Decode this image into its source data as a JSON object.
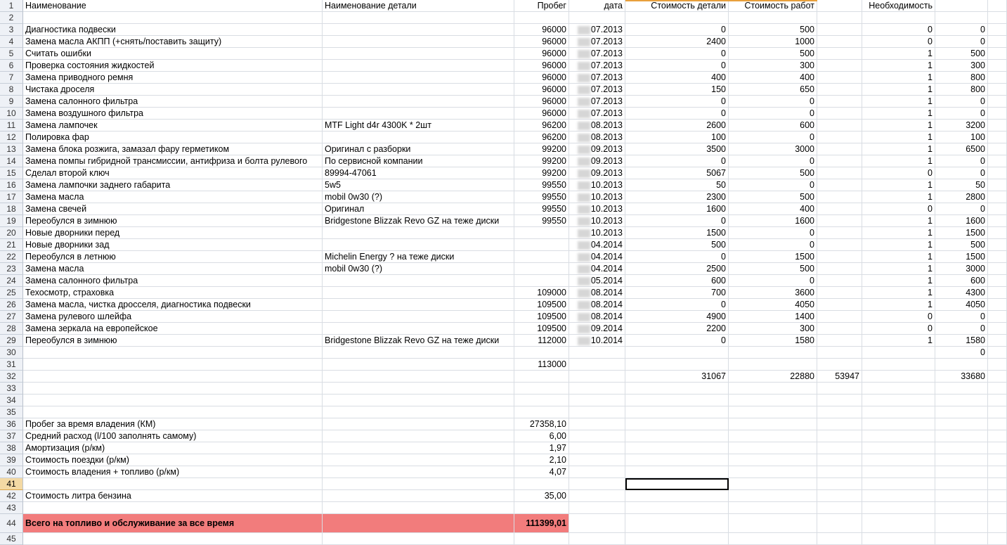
{
  "headers": [
    "Наименование",
    "Наименование детали",
    "Пробег",
    "дата",
    "Стоимость детали",
    "Стоимость работ",
    "",
    "Необходимость",
    ""
  ],
  "active_row": 41,
  "selected_cell": {
    "row": 41,
    "col": 4
  },
  "highlight_row": 44,
  "rows": [
    {
      "n": "2",
      "c": [
        "",
        "",
        "",
        "",
        "",
        "",
        "",
        "",
        ""
      ]
    },
    {
      "n": "3",
      "c": [
        "Диагностика подвески",
        "",
        "96000",
        "07.2013",
        "0",
        "500",
        "",
        "0",
        "0"
      ]
    },
    {
      "n": "4",
      "c": [
        "Замена масла АКПП (+снять/поставить защиту)",
        "",
        "96000",
        "07.2013",
        "2400",
        "1000",
        "",
        "0",
        "0"
      ]
    },
    {
      "n": "5",
      "c": [
        "Считать ошибки",
        "",
        "96000",
        "07.2013",
        "0",
        "500",
        "",
        "1",
        "500"
      ]
    },
    {
      "n": "6",
      "c": [
        "Проверка состояния жидкостей",
        "",
        "96000",
        "07.2013",
        "0",
        "300",
        "",
        "1",
        "300"
      ]
    },
    {
      "n": "7",
      "c": [
        "Замена приводного ремня",
        "",
        "96000",
        "07.2013",
        "400",
        "400",
        "",
        "1",
        "800"
      ]
    },
    {
      "n": "8",
      "c": [
        "Чистака дроселя",
        "",
        "96000",
        "07.2013",
        "150",
        "650",
        "",
        "1",
        "800"
      ]
    },
    {
      "n": "9",
      "c": [
        "Замена салонного фильтра",
        "",
        "96000",
        "07.2013",
        "0",
        "0",
        "",
        "1",
        "0"
      ]
    },
    {
      "n": "10",
      "c": [
        "Замена воздушного фильтра",
        "",
        "96000",
        "07.2013",
        "0",
        "0",
        "",
        "1",
        "0"
      ]
    },
    {
      "n": "11",
      "c": [
        "Замена лампочек",
        "MTF Light d4r 4300K * 2шт",
        "96200",
        "08.2013",
        "2600",
        "600",
        "",
        "1",
        "3200"
      ]
    },
    {
      "n": "12",
      "c": [
        "Полировка фар",
        "",
        "96200",
        "08.2013",
        "100",
        "0",
        "",
        "1",
        "100"
      ]
    },
    {
      "n": "13",
      "c": [
        "Замена блока розжига, замазал фару герметиком",
        "Оригинал с разборки",
        "99200",
        "09.2013",
        "3500",
        "3000",
        "",
        "1",
        "6500"
      ]
    },
    {
      "n": "14",
      "c": [
        "Замена помпы гибридной трансмиссии, антифриза и болта рулевого",
        "По сервисной компании",
        "99200",
        "09.2013",
        "0",
        "0",
        "",
        "1",
        "0"
      ]
    },
    {
      "n": "15",
      "c": [
        "Сделал второй ключ",
        "89994-47061",
        "99200",
        "09.2013",
        "5067",
        "500",
        "",
        "0",
        "0"
      ]
    },
    {
      "n": "16",
      "c": [
        "Замена лампочки заднего габарита",
        "5w5",
        "99550",
        "10.2013",
        "50",
        "0",
        "",
        "1",
        "50"
      ]
    },
    {
      "n": "17",
      "c": [
        "Замена масла",
        "mobil 0w30 (?)",
        "99550",
        "10.2013",
        "2300",
        "500",
        "",
        "1",
        "2800"
      ]
    },
    {
      "n": "18",
      "c": [
        "Замена свечей",
        "Оригинал",
        "99550",
        "10.2013",
        "1600",
        "400",
        "",
        "0",
        "0"
      ]
    },
    {
      "n": "19",
      "c": [
        "Переобулся в зимнюю",
        "Bridgestone Blizzak Revo GZ на теже диски",
        "99550",
        "10.2013",
        "0",
        "1600",
        "",
        "1",
        "1600"
      ]
    },
    {
      "n": "20",
      "c": [
        "Новые дворники перед",
        "",
        "",
        "10.2013",
        "1500",
        "0",
        "",
        "1",
        "1500"
      ]
    },
    {
      "n": "21",
      "c": [
        "Новые дворники зад",
        "",
        "",
        "04.2014",
        "500",
        "0",
        "",
        "1",
        "500"
      ]
    },
    {
      "n": "22",
      "c": [
        "Переобулся в летнюю",
        "Michelin Energy ? на теже диски",
        "",
        "04.2014",
        "0",
        "1500",
        "",
        "1",
        "1500"
      ]
    },
    {
      "n": "23",
      "c": [
        "Замена масла",
        "mobil 0w30 (?)",
        "",
        "04.2014",
        "2500",
        "500",
        "",
        "1",
        "3000"
      ]
    },
    {
      "n": "24",
      "c": [
        "Замена салонного фильтра",
        "",
        "",
        "05.2014",
        "600",
        "0",
        "",
        "1",
        "600"
      ]
    },
    {
      "n": "25",
      "c": [
        "Техосмотр, страховка",
        "",
        "109000",
        "08.2014",
        "700",
        "3600",
        "",
        "1",
        "4300"
      ]
    },
    {
      "n": "26",
      "c": [
        "Замена масла, чистка дросселя, диагностика подвески",
        "",
        "109500",
        "08.2014",
        "0",
        "4050",
        "",
        "1",
        "4050"
      ]
    },
    {
      "n": "27",
      "c": [
        "Замена рулевого шлейфа",
        "",
        "109500",
        "08.2014",
        "4900",
        "1400",
        "",
        "0",
        "0"
      ]
    },
    {
      "n": "28",
      "c": [
        "Замена зеркала на европейское",
        "",
        "109500",
        "09.2014",
        "2200",
        "300",
        "",
        "0",
        "0"
      ]
    },
    {
      "n": "29",
      "c": [
        "Переобулся в зимнюю",
        "Bridgestone Blizzak Revo GZ на теже диски",
        "112000",
        "10.2014",
        "0",
        "1580",
        "",
        "1",
        "1580"
      ]
    },
    {
      "n": "30",
      "c": [
        "",
        "",
        "",
        "",
        "",
        "",
        "",
        "",
        "0"
      ]
    },
    {
      "n": "31",
      "c": [
        "",
        "",
        "113000",
        "",
        "",
        "",
        "",
        "",
        ""
      ]
    },
    {
      "n": "32",
      "c": [
        "",
        "",
        "",
        "",
        "31067",
        "22880",
        "53947",
        "",
        "33680"
      ]
    },
    {
      "n": "33",
      "c": [
        "",
        "",
        "",
        "",
        "",
        "",
        "",
        "",
        ""
      ]
    },
    {
      "n": "34",
      "c": [
        "",
        "",
        "",
        "",
        "",
        "",
        "",
        "",
        ""
      ]
    },
    {
      "n": "35",
      "c": [
        "",
        "",
        "",
        "",
        "",
        "",
        "",
        "",
        ""
      ]
    },
    {
      "n": "36",
      "c": [
        "Пробег за время владения (КМ)",
        "",
        "27358,10",
        "",
        "",
        "",
        "",
        "",
        ""
      ]
    },
    {
      "n": "37",
      "c": [
        "Средний расход (l/100 заполнять самому)",
        "",
        "6,00",
        "",
        "",
        "",
        "",
        "",
        ""
      ]
    },
    {
      "n": "38",
      "c": [
        "Амортизация (р/км)",
        "",
        "1,97",
        "",
        "",
        "",
        "",
        "",
        ""
      ]
    },
    {
      "n": "39",
      "c": [
        "Стоимость поездки (р/км)",
        "",
        "2,10",
        "",
        "",
        "",
        "",
        "",
        ""
      ]
    },
    {
      "n": "40",
      "c": [
        "Стоимость владения + топливо (р/км)",
        "",
        "4,07",
        "",
        "",
        "",
        "",
        "",
        ""
      ]
    },
    {
      "n": "41",
      "c": [
        "",
        "",
        "",
        "",
        "",
        "",
        "",
        "",
        ""
      ]
    },
    {
      "n": "42",
      "c": [
        "Стоимость литра бензина",
        "",
        "35,00",
        "",
        "",
        "",
        "",
        "",
        ""
      ]
    },
    {
      "n": "43",
      "c": [
        "",
        "",
        "",
        "",
        "",
        "",
        "",
        "",
        ""
      ]
    },
    {
      "n": "44",
      "c": [
        "Всего на топливо и обслуживание за все время",
        "",
        "111399,01",
        "",
        "",
        "",
        "",
        "",
        ""
      ]
    },
    {
      "n": "45",
      "c": [
        "",
        "",
        "",
        "",
        "",
        "",
        "",
        "",
        ""
      ]
    }
  ]
}
